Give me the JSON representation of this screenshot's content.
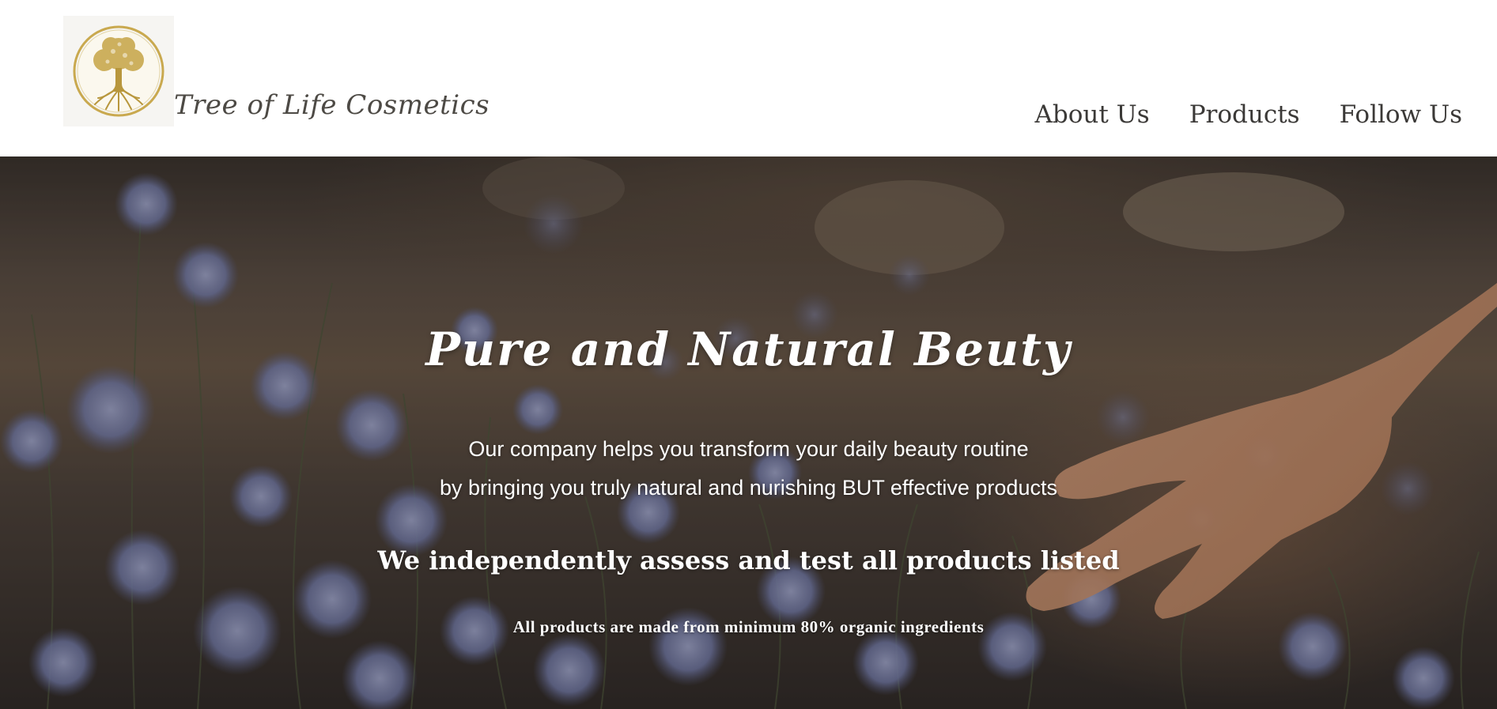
{
  "brand": {
    "name": "Tree of Life Cosmetics",
    "logo_icon": "tree-of-life-icon",
    "logo_color": "#c9a94f"
  },
  "nav": {
    "items": [
      {
        "label": "About Us"
      },
      {
        "label": "Products"
      },
      {
        "label": "Follow Us"
      }
    ]
  },
  "hero": {
    "title": "Pure and Natural Beuty",
    "line_1": "Our company helps you transform your daily beauty routine",
    "line_2": "by bringing you truly natural and nurishing BUT effective products",
    "claim": "We independently assess and test all products listed",
    "note": "All products are made from minimum 80% organic ingredients",
    "text_color": "#ffffff",
    "flower_color": "#7a86b8"
  }
}
